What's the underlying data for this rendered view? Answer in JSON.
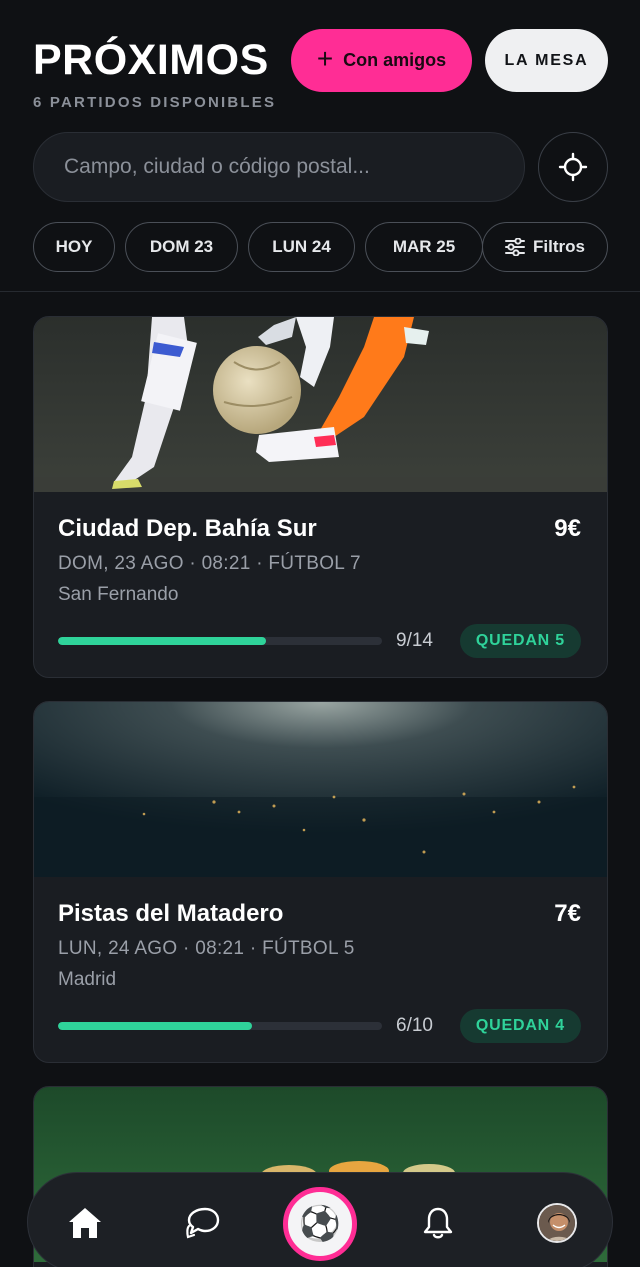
{
  "header": {
    "title": "PRÓXIMOS",
    "subtitle": "6 PARTIDOS DISPONIBLES",
    "friends_button": {
      "icon": "plus-icon",
      "label": "Con amigos"
    },
    "table_button": {
      "label": "LA MESA"
    }
  },
  "search": {
    "placeholder": "Campo, ciudad o código postal...",
    "value": "",
    "locate_icon": "crosshair-icon"
  },
  "date_chips": [
    {
      "label": "HOY"
    },
    {
      "label": "DOM 23"
    },
    {
      "label": "LUN 24"
    },
    {
      "label": "MAR 25"
    }
  ],
  "filters_chip": {
    "icon": "sliders-icon",
    "label": "Filtros"
  },
  "matches": [
    {
      "name": "Ciudad Dep. Bahía Sur",
      "price": "9€",
      "meta": "DOM, 23 AGO · 08:21 · FÚTBOL 7",
      "city": "San Fernando",
      "players": "9/14",
      "players_fraction": 0.643,
      "spots_left": "QUEDAN 5"
    },
    {
      "name": "Pistas del Matadero",
      "price": "7€",
      "meta": "LUN, 24 AGO · 08:21 · FÚTBOL 5",
      "city": "Madrid",
      "players": "6/10",
      "players_fraction": 0.6,
      "spots_left": "QUEDAN 4"
    }
  ],
  "bottom_nav": {
    "items": [
      "home-icon",
      "chat-icon",
      "soccer-ball-icon",
      "bell-icon",
      "avatar"
    ],
    "active": "soccer-ball-icon",
    "center_glyph": "⚽"
  },
  "colors": {
    "background": "#0f1114",
    "accent_pink": "#ff2d95",
    "accent_green": "#2fd39a",
    "card": "#1a1d22"
  }
}
